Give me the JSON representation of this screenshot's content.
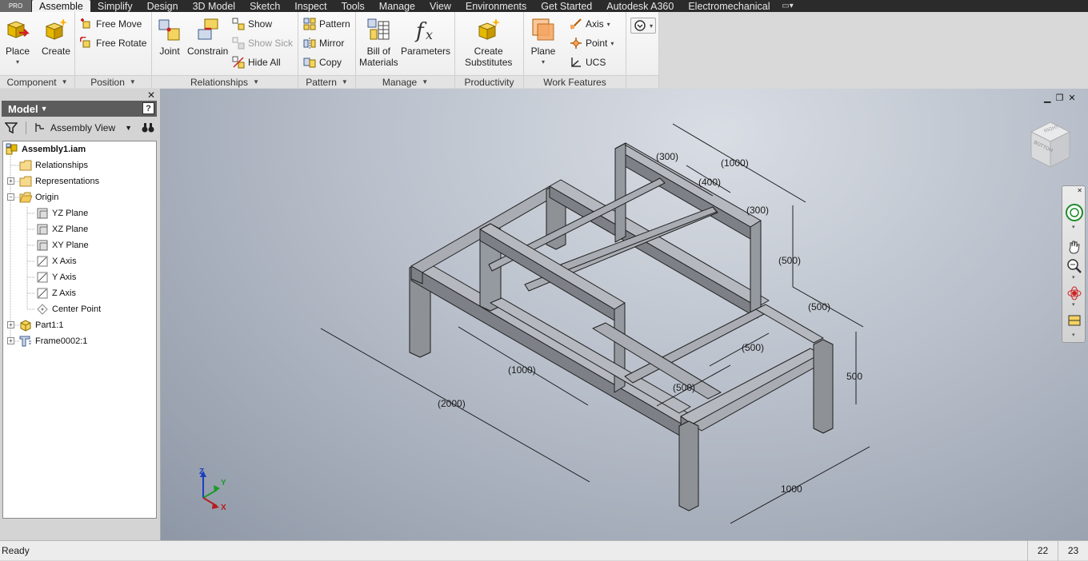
{
  "tabs": [
    "Assemble",
    "Simplify",
    "Design",
    "3D Model",
    "Sketch",
    "Inspect",
    "Tools",
    "Manage",
    "View",
    "Environments",
    "Get Started",
    "Autodesk A360",
    "Electromechanical"
  ],
  "pro_badge": "PRO",
  "ribbon": {
    "component": {
      "place": "Place",
      "create": "Create",
      "footer": "Component"
    },
    "position": {
      "free_move": "Free Move",
      "free_rotate": "Free Rotate",
      "footer": "Position"
    },
    "relationships": {
      "joint": "Joint",
      "constrain": "Constrain",
      "show": "Show",
      "show_sick": "Show Sick",
      "hide_all": "Hide All",
      "footer": "Relationships"
    },
    "pattern": {
      "pattern": "Pattern",
      "mirror": "Mirror",
      "copy": "Copy",
      "footer": "Pattern"
    },
    "manage": {
      "bom_line1": "Bill of",
      "bom_line2": "Materials",
      "parameters": "Parameters",
      "footer": "Manage"
    },
    "productivity": {
      "line1": "Create",
      "line2": "Substitutes",
      "footer": "Productivity"
    },
    "work_features": {
      "plane": "Plane",
      "axis": "Axis",
      "point": "Point",
      "ucs": "UCS",
      "footer": "Work Features"
    }
  },
  "browser": {
    "title": "Model",
    "help": "?",
    "view_mode": "Assembly View",
    "tree": [
      {
        "label": "Assembly1.iam",
        "icon": "assembly-icon"
      },
      {
        "label": "Relationships",
        "icon": "folder-icon"
      },
      {
        "label": "Representations",
        "icon": "folder-icon"
      },
      {
        "label": "Origin",
        "icon": "folder-open-icon"
      },
      {
        "label": "YZ Plane",
        "icon": "plane-icon"
      },
      {
        "label": "XZ Plane",
        "icon": "plane-icon"
      },
      {
        "label": "XY Plane",
        "icon": "plane-icon"
      },
      {
        "label": "X Axis",
        "icon": "axis-icon"
      },
      {
        "label": "Y Axis",
        "icon": "axis-icon"
      },
      {
        "label": "Z Axis",
        "icon": "axis-icon"
      },
      {
        "label": "Center Point",
        "icon": "point-icon"
      },
      {
        "label": "Part1:1",
        "icon": "part-icon"
      },
      {
        "label": "Frame0002:1",
        "icon": "frame-icon"
      }
    ]
  },
  "viewport": {
    "dimensions": [
      "(300)",
      "(1000)",
      "(400)",
      "(300)",
      "(500)",
      "(500)",
      "(500)",
      "500",
      "(1000)",
      "(500)",
      "(2000)",
      "1000"
    ],
    "triad": {
      "x": "X",
      "y": "Y",
      "z": "Z"
    },
    "viewcube_labels": {
      "front": "BOTTOM",
      "top": "RIGHT"
    }
  },
  "status": {
    "text": "Ready",
    "num1": "22",
    "num2": "23"
  },
  "colors": {
    "tab_bar": "#2b2b2b",
    "viewport_bg": "#b9c0cb",
    "frame_face": "#9a9ea3"
  }
}
